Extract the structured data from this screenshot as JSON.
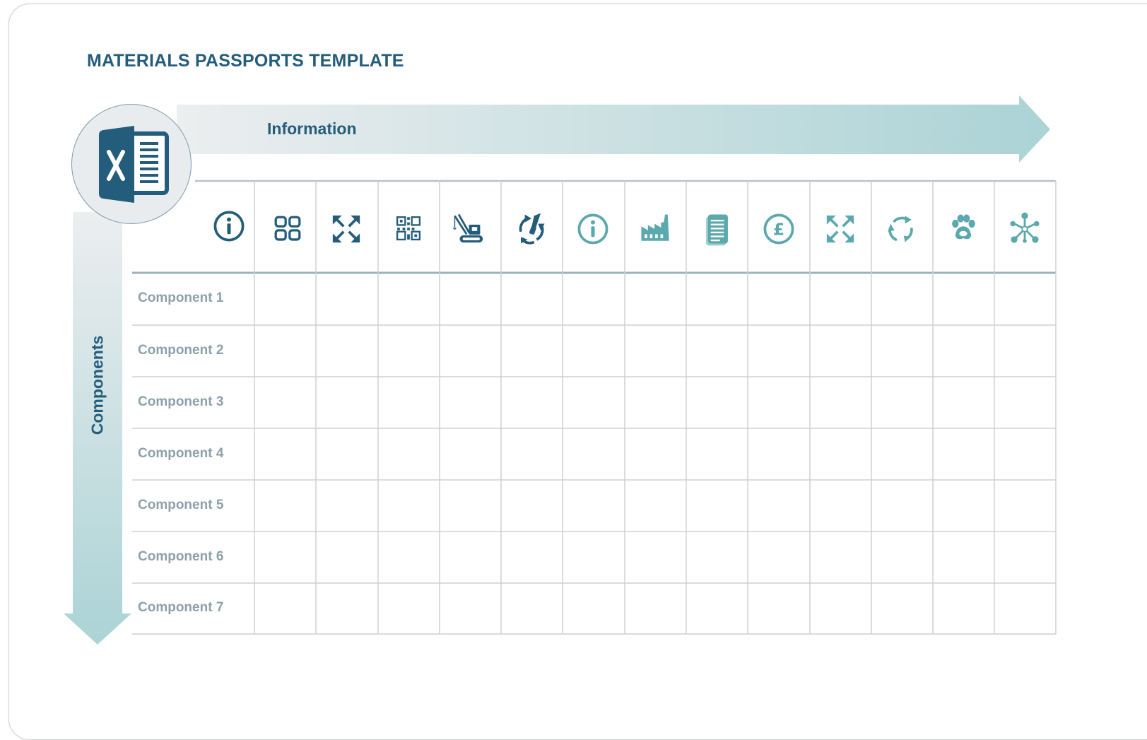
{
  "title": "MATERIALS PASSPORTS TEMPLATE",
  "axis_information": "Information",
  "axis_components": "Components",
  "file_icon": "spreadsheet-icon",
  "colors": {
    "dark": "#245d7c",
    "teal": "#5ba8ad",
    "grid": "#c9cdd0",
    "label": "#8ea0ab"
  },
  "columns": [
    {
      "icon": "info-icon",
      "tone": "dark"
    },
    {
      "icon": "grid-squares-icon",
      "tone": "dark"
    },
    {
      "icon": "expand-arrows-icon",
      "tone": "dark"
    },
    {
      "icon": "qr-code-icon",
      "tone": "dark"
    },
    {
      "icon": "crane-icon",
      "tone": "dark"
    },
    {
      "icon": "recycle-tools-icon",
      "tone": "dark"
    },
    {
      "icon": "info-icon",
      "tone": "teal"
    },
    {
      "icon": "factory-icon",
      "tone": "teal"
    },
    {
      "icon": "document-icon",
      "tone": "teal"
    },
    {
      "icon": "pound-icon",
      "tone": "teal"
    },
    {
      "icon": "expand-arrows-icon",
      "tone": "teal"
    },
    {
      "icon": "recycle-icon",
      "tone": "teal"
    },
    {
      "icon": "paw-icon",
      "tone": "teal"
    },
    {
      "icon": "network-icon",
      "tone": "teal"
    }
  ],
  "rows": [
    "Component 1",
    "Component 2",
    "Component 3",
    "Component 4",
    "Component 5",
    "Component 6",
    "Component 7"
  ]
}
